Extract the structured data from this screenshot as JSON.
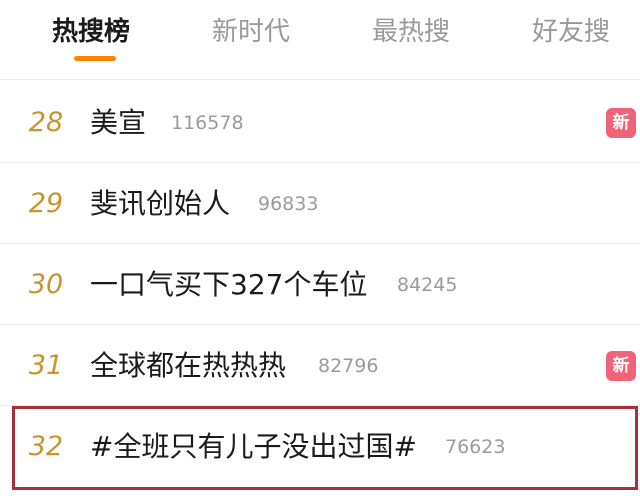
{
  "tabs": [
    {
      "label": "热搜榜",
      "active": true
    },
    {
      "label": "新时代",
      "active": false
    },
    {
      "label": "最热搜",
      "active": false
    },
    {
      "label": "好友搜",
      "active": false
    }
  ],
  "colors": {
    "accent_indicator": "#ff8200",
    "rank_gold": "#c9952a",
    "new_badge": "#f0647a",
    "highlight_border": "#a8303a"
  },
  "list": [
    {
      "rank": "28",
      "title": "美宣",
      "count": "116578",
      "badge": "新"
    },
    {
      "rank": "29",
      "title": "斐讯创始人",
      "count": "96833",
      "badge": ""
    },
    {
      "rank": "30",
      "title": "一口气买下327个车位",
      "count": "84245",
      "badge": ""
    },
    {
      "rank": "31",
      "title": "全球都在热热热",
      "count": "82796",
      "badge": "新"
    },
    {
      "rank": "32",
      "title": "#全班只有儿子没出过国#",
      "count": "76623",
      "badge": "",
      "highlighted": true
    }
  ]
}
